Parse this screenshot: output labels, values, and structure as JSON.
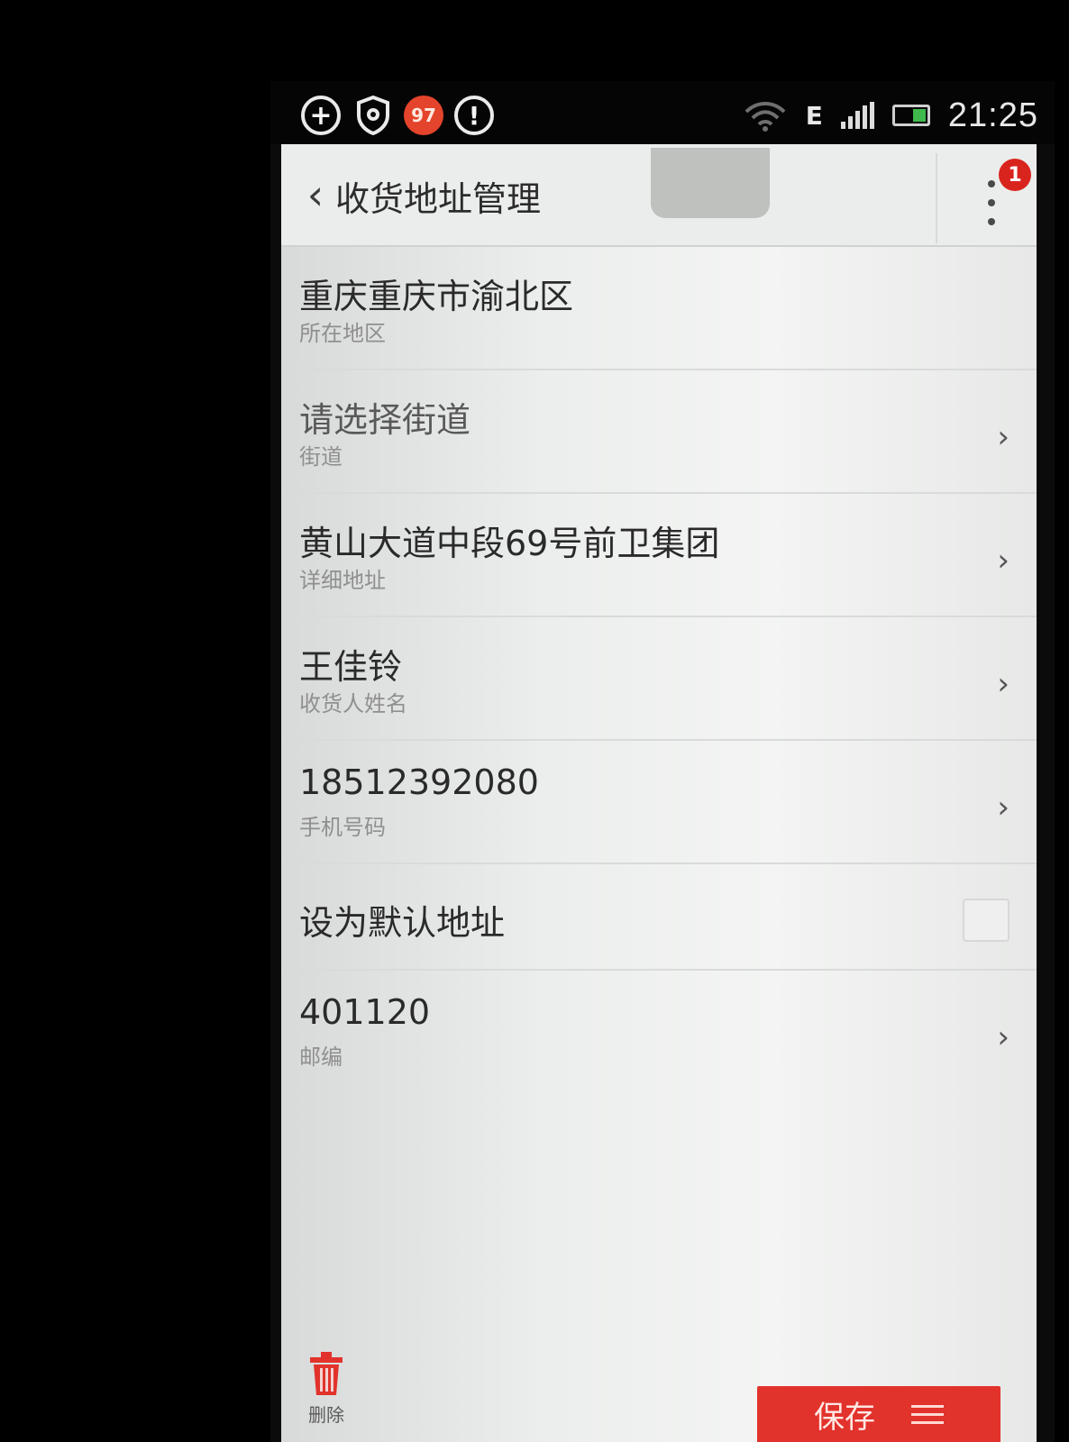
{
  "status_bar": {
    "badge_count": "97",
    "network_type": "E",
    "time": "21:25",
    "icons": [
      "add-circle-icon",
      "shield-gear-icon",
      "notification-badge",
      "alert-circle-icon",
      "wifi-icon",
      "signal-icon",
      "battery-icon"
    ]
  },
  "header": {
    "title": "收货地址管理",
    "menu_badge": "1"
  },
  "fields": [
    {
      "value": "重庆重庆市渝北区",
      "label": "所在地区",
      "has_chevron": false
    },
    {
      "value": "请选择街道",
      "label": "街道",
      "has_chevron": true
    },
    {
      "value": "黄山大道中段69号前卫集团",
      "label": "详细地址",
      "has_chevron": true
    },
    {
      "value": "王佳铃",
      "label": "收货人姓名",
      "has_chevron": true
    },
    {
      "value": "18512392080",
      "label": "手机号码",
      "has_chevron": true
    },
    {
      "value": "设为默认地址",
      "checkbox": true
    },
    {
      "value": "401120",
      "label": "邮编",
      "has_chevron": true
    }
  ],
  "footer": {
    "delete_label": "删除",
    "save_label": "保存"
  },
  "colors": {
    "accent": "#e2322c",
    "badge": "#d9241e",
    "status_badge": "#e4442b"
  }
}
